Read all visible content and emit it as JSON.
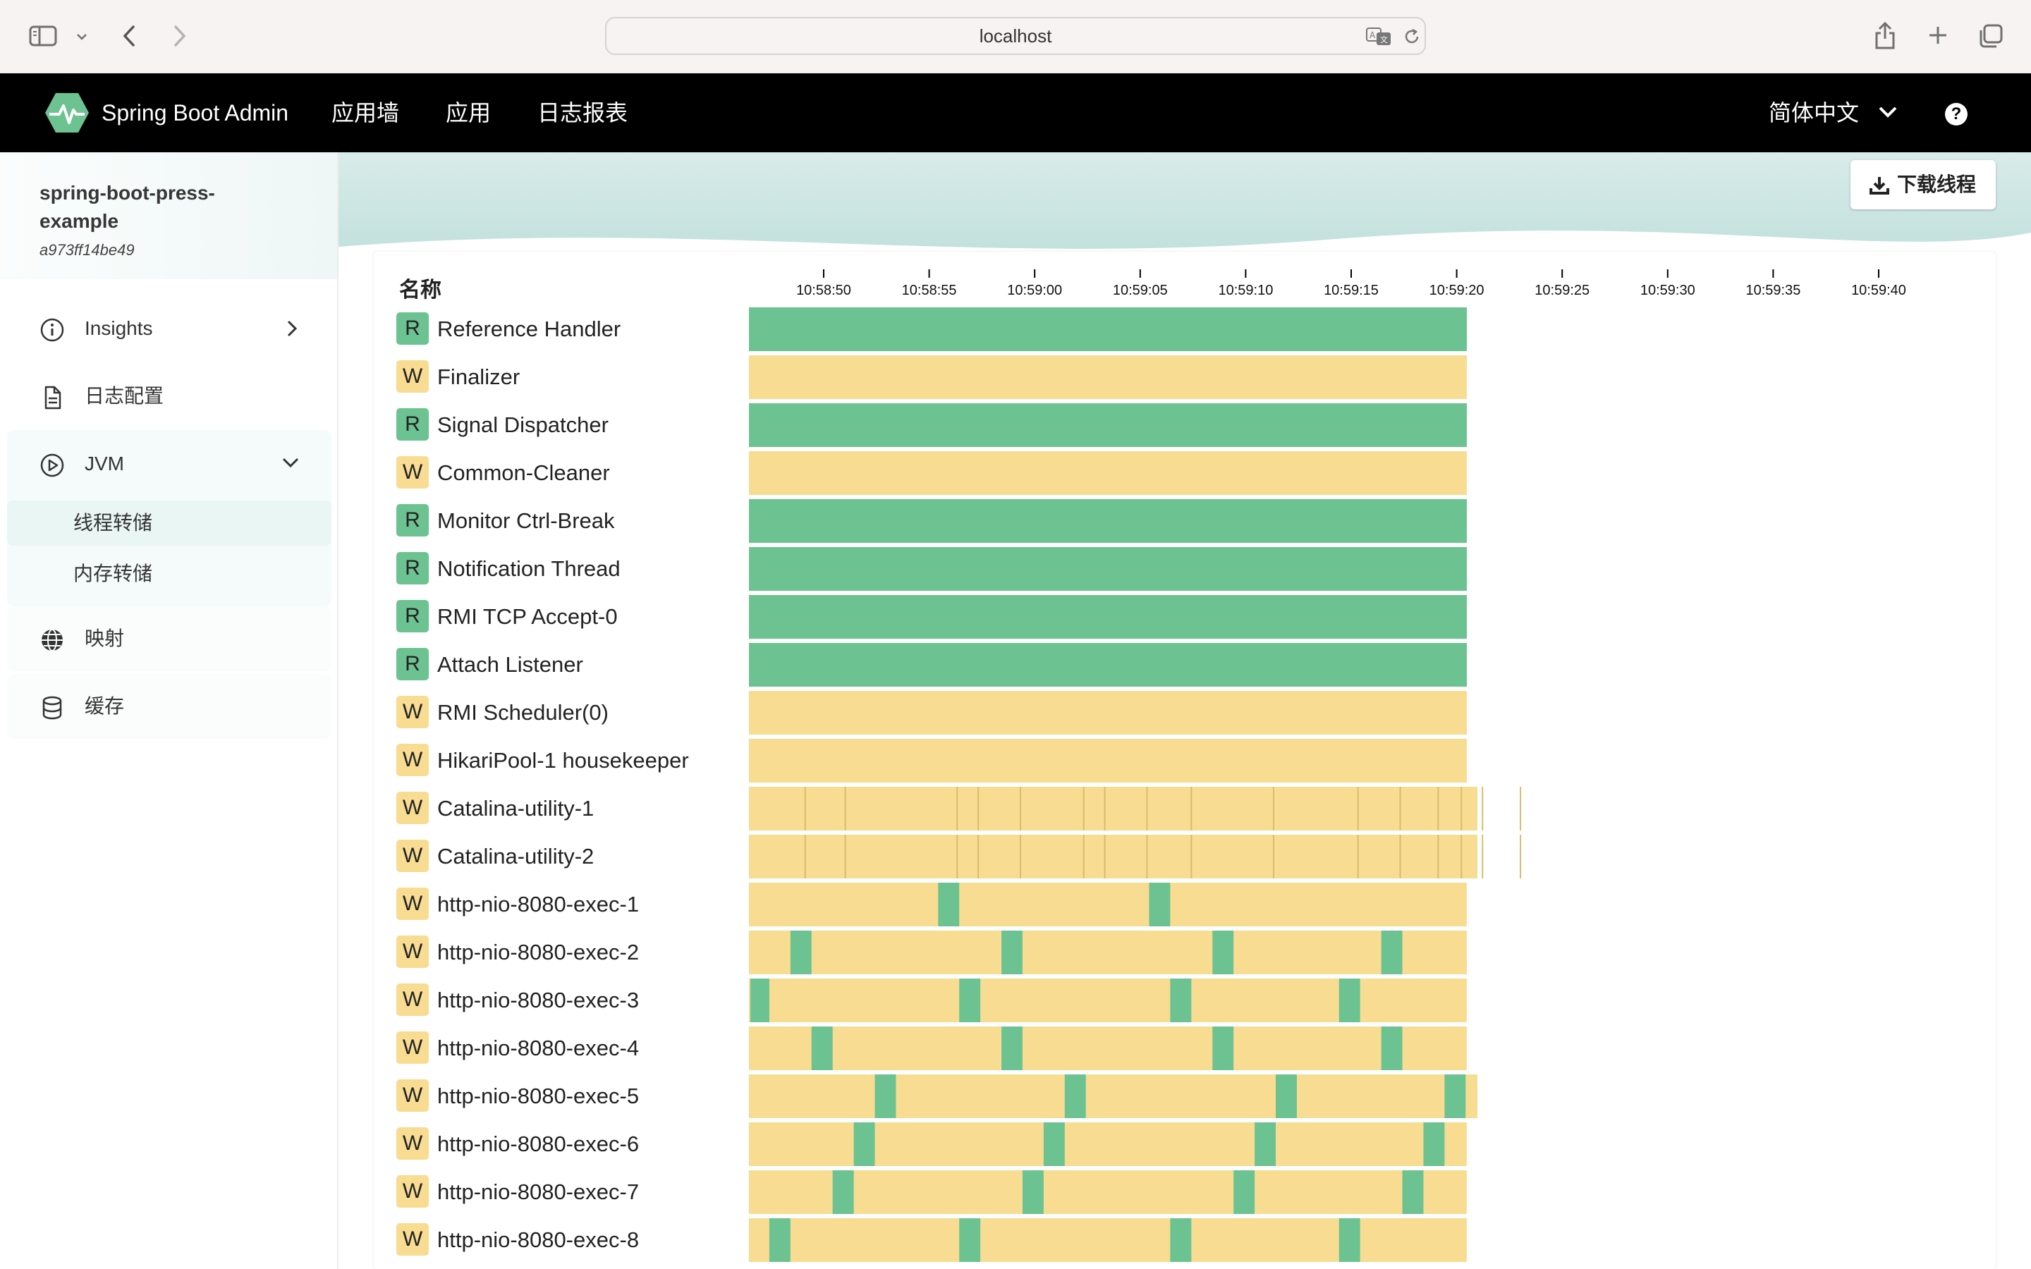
{
  "browser": {
    "url": "localhost"
  },
  "navbar": {
    "brand": "Spring Boot Admin",
    "links": [
      "应用墙",
      "应用",
      "日志报表"
    ],
    "language": "简体中文",
    "help": "?"
  },
  "sidebar": {
    "app_name": "spring-boot-press-example",
    "app_id": "a973ff14be49",
    "items": [
      {
        "label": "Insights",
        "icon": "info-circle-icon"
      },
      {
        "label": "日志配置",
        "icon": "document-icon"
      },
      {
        "label": "JVM",
        "icon": "play-circle-icon"
      },
      {
        "label": "映射",
        "icon": "globe-icon"
      },
      {
        "label": "缓存",
        "icon": "database-icon"
      }
    ],
    "jvm_subitems": [
      {
        "label": "线程转储"
      },
      {
        "label": "内存转储"
      }
    ]
  },
  "toolbar": {
    "download_label": "下载线程"
  },
  "threads": {
    "column_title": "名称",
    "time_ticks": [
      "10:58:50",
      "10:58:55",
      "10:59:00",
      "10:59:05",
      "10:59:10",
      "10:59:15",
      "10:59:20",
      "10:59:25",
      "10:59:30",
      "10:59:35",
      "10:59:40"
    ],
    "colors": {
      "R": "#6cc391",
      "W": "#f7dc92",
      "divider": "#d8bd6e"
    },
    "rows": [
      {
        "state": "R",
        "name": "Reference Handler",
        "green": [],
        "dividers": []
      },
      {
        "state": "W",
        "name": "Finalizer",
        "green": [],
        "dividers": []
      },
      {
        "state": "R",
        "name": "Signal Dispatcher",
        "green": [],
        "dividers": []
      },
      {
        "state": "W",
        "name": "Common-Cleaner",
        "green": [],
        "dividers": []
      },
      {
        "state": "R",
        "name": "Monitor Ctrl-Break",
        "green": [],
        "dividers": []
      },
      {
        "state": "R",
        "name": "Notification Thread",
        "green": [],
        "dividers": []
      },
      {
        "state": "R",
        "name": "RMI TCP Accept-0",
        "green": [],
        "dividers": []
      },
      {
        "state": "R",
        "name": "Attach Listener",
        "green": [],
        "dividers": []
      },
      {
        "state": "W",
        "name": "RMI Scheduler(0)",
        "green": [],
        "dividers": []
      },
      {
        "state": "W",
        "name": "HikariPool-1 housekeeper",
        "green": [],
        "dividers": []
      },
      {
        "state": "W",
        "name": "Catalina-utility-1",
        "green": [],
        "dividers": [
          10.6,
          12.5,
          17.8,
          18.8,
          20.8,
          23.8,
          24.8,
          26.8,
          28.9,
          32.8,
          36.8,
          38.8,
          40.6,
          41.7,
          42.7,
          44.5
        ],
        "extend": 0.5
      },
      {
        "state": "W",
        "name": "Catalina-utility-2",
        "green": [],
        "dividers": [
          10.6,
          12.5,
          17.8,
          18.8,
          20.8,
          23.8,
          24.8,
          26.8,
          28.9,
          32.8,
          36.8,
          38.8,
          40.6,
          41.7,
          42.7,
          44.5
        ],
        "extend": 0.5
      },
      {
        "state": "W",
        "name": "http-nio-8080-exec-1",
        "green": [
          [
            16.9,
            17.9
          ],
          [
            26.9,
            27.9
          ]
        ],
        "dividers": []
      },
      {
        "state": "W",
        "name": "http-nio-8080-exec-2",
        "green": [
          [
            9.9,
            10.9
          ],
          [
            19.9,
            20.9
          ],
          [
            29.9,
            30.9
          ],
          [
            37.9,
            38.9
          ]
        ],
        "dividers": []
      },
      {
        "state": "W",
        "name": "http-nio-8080-exec-3",
        "green": [
          [
            8.0,
            8.9
          ],
          [
            17.9,
            18.9
          ],
          [
            27.9,
            28.9
          ],
          [
            35.9,
            36.9
          ]
        ],
        "dividers": []
      },
      {
        "state": "W",
        "name": "http-nio-8080-exec-4",
        "green": [
          [
            10.9,
            11.9
          ],
          [
            19.9,
            20.9
          ],
          [
            29.9,
            30.9
          ],
          [
            37.9,
            38.9
          ]
        ],
        "dividers": []
      },
      {
        "state": "W",
        "name": "http-nio-8080-exec-5",
        "green": [
          [
            13.9,
            14.9
          ],
          [
            22.9,
            23.9
          ],
          [
            32.9,
            33.9
          ],
          [
            40.9,
            41.9
          ]
        ],
        "dividers": [],
        "extend": 0.5
      },
      {
        "state": "W",
        "name": "http-nio-8080-exec-6",
        "green": [
          [
            12.9,
            13.9
          ],
          [
            21.9,
            22.9
          ],
          [
            31.9,
            32.9
          ],
          [
            39.9,
            40.9
          ]
        ],
        "dividers": []
      },
      {
        "state": "W",
        "name": "http-nio-8080-exec-7",
        "green": [
          [
            11.9,
            12.9
          ],
          [
            20.9,
            21.9
          ],
          [
            30.9,
            31.9
          ],
          [
            38.9,
            39.9
          ]
        ],
        "dividers": []
      },
      {
        "state": "W",
        "name": "http-nio-8080-exec-8",
        "green": [
          [
            8.9,
            9.9
          ],
          [
            17.9,
            18.9
          ],
          [
            27.9,
            28.9
          ],
          [
            35.9,
            36.9
          ]
        ],
        "dividers": []
      }
    ]
  }
}
